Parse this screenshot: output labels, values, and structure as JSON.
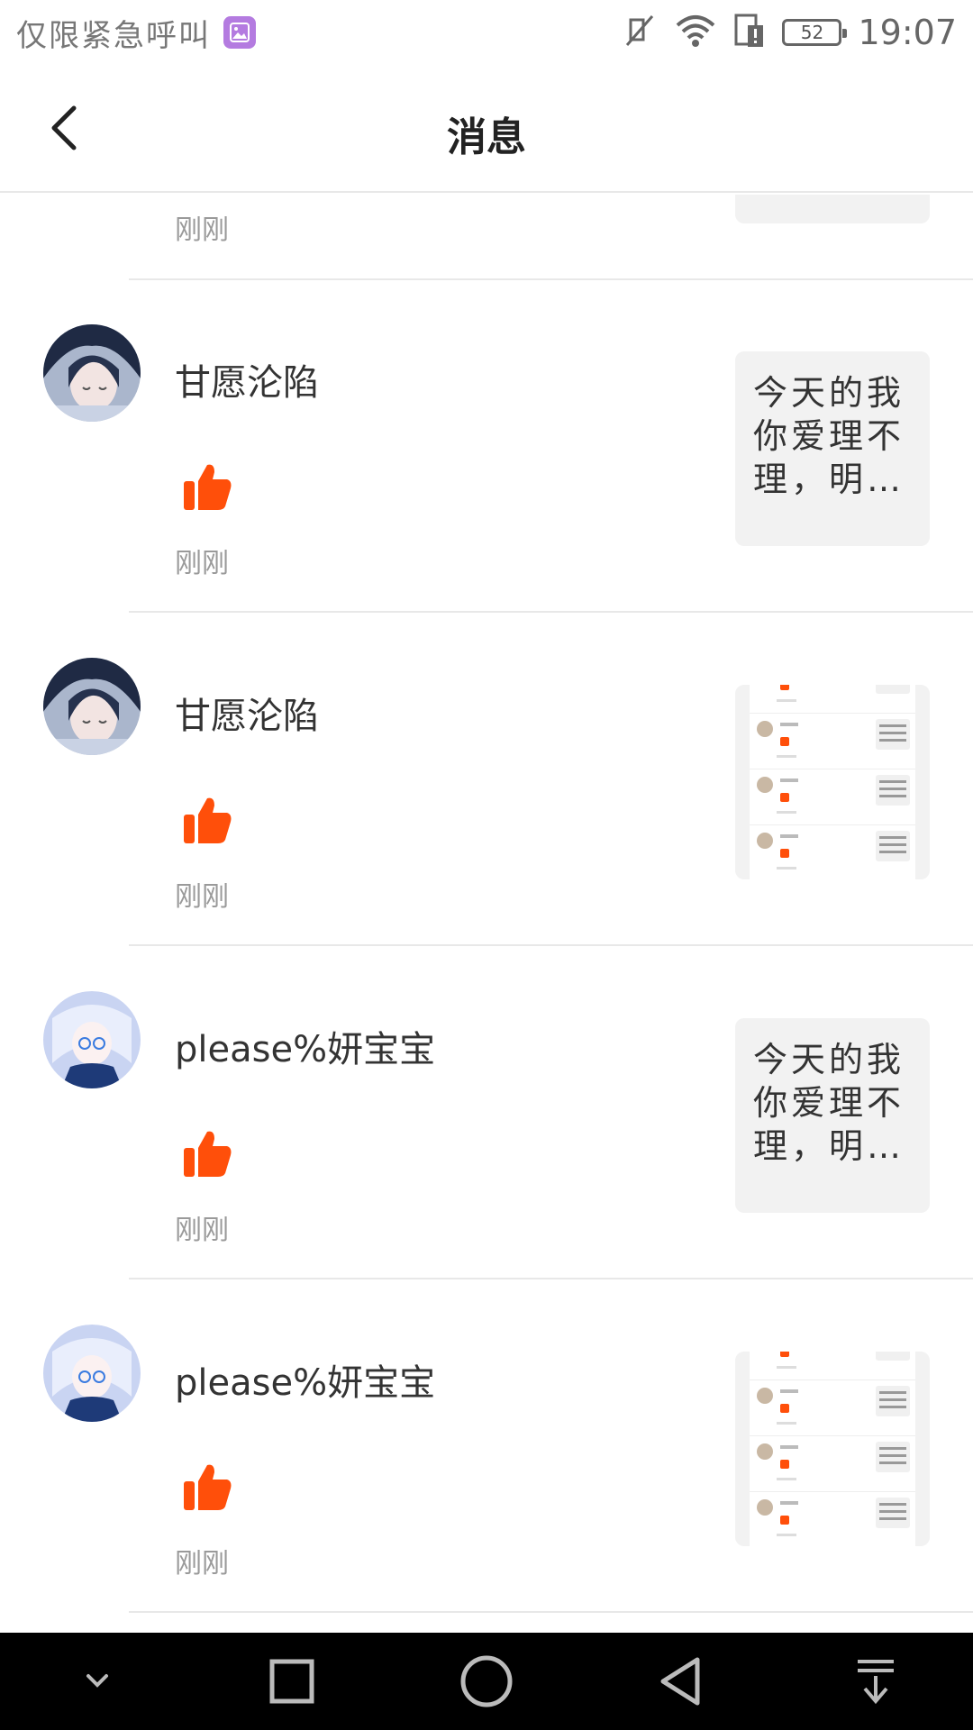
{
  "status_bar": {
    "carrier_text": "仅限紧急呼叫",
    "battery_level": "52",
    "time": "19:07"
  },
  "header": {
    "title": "消息"
  },
  "partial_row": {
    "time": "刚刚"
  },
  "rows": [
    {
      "username": "甘愿沦陷",
      "time": "刚刚",
      "thumb_type": "text",
      "thumb_text": "今天的我你爱理不理，明…"
    },
    {
      "username": "甘愿沦陷",
      "time": "刚刚",
      "thumb_type": "image"
    },
    {
      "username": "please%妍宝宝",
      "time": "刚刚",
      "thumb_type": "text",
      "thumb_text": "今天的我你爱理不理，明…"
    },
    {
      "username": "please%妍宝宝",
      "time": "刚刚",
      "thumb_type": "image"
    }
  ],
  "colors": {
    "like": "#ff4f0a",
    "divider": "#e8e8e8",
    "muted_text": "#9a9a9a",
    "thumb_bg": "#f2f2f2"
  },
  "icons": {
    "back": "chevron-left-icon",
    "like": "thumbs-up-icon",
    "nav_down": "chevron-down-icon",
    "nav_recent": "square-icon",
    "nav_home": "circle-icon",
    "nav_back": "triangle-back-icon",
    "nav_notification": "pull-down-icon"
  }
}
